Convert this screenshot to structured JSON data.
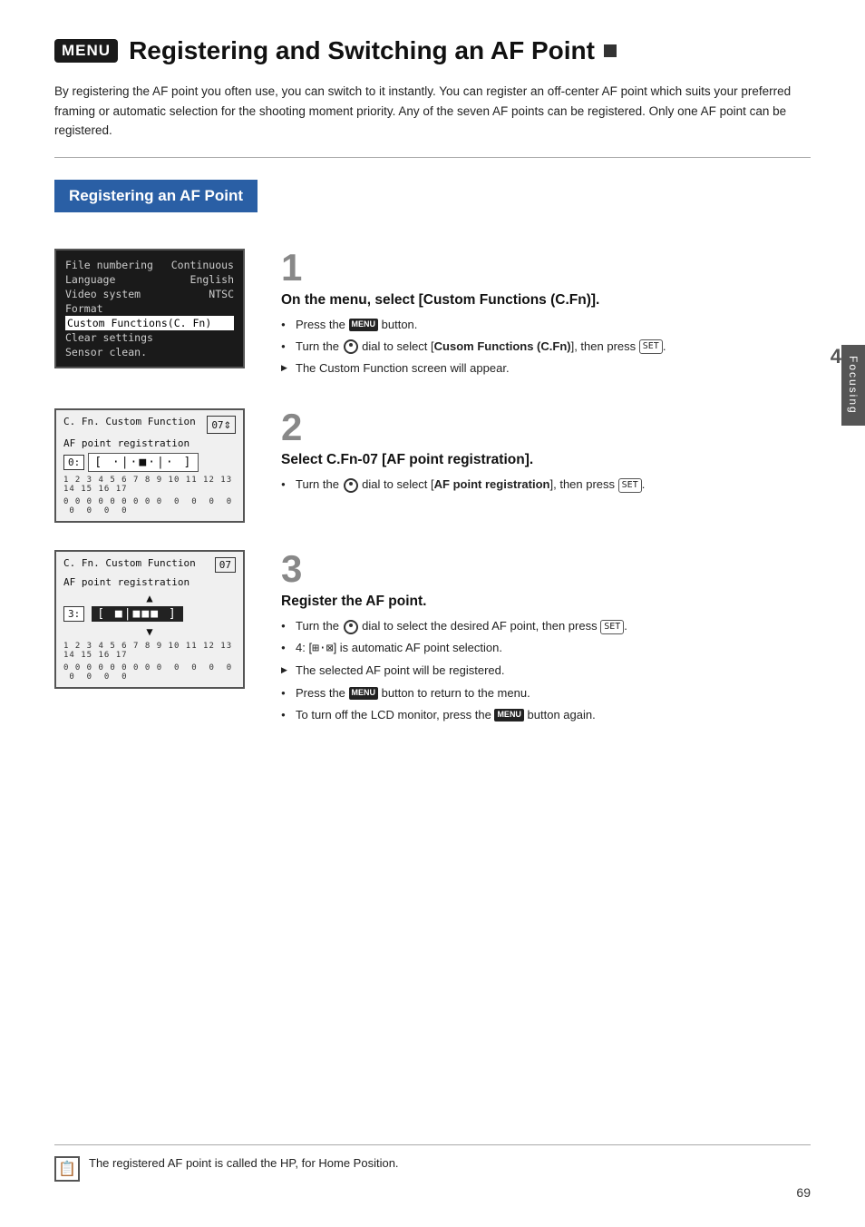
{
  "page": {
    "menu_badge": "MENU",
    "title": "Registering and Switching an AF Point",
    "intro": "By registering the AF point you often use, you can switch to it instantly. You can register an off-center AF point which suits your preferred framing or automatic selection for the shooting moment priority. Any of the seven AF points can be registered. Only one AF point can be registered.",
    "section_header": "Registering an AF Point",
    "side_tab": "Focusing",
    "side_number": "4",
    "page_number": "69",
    "footer_note": "The registered AF point is called the HP, for Home Position."
  },
  "step1": {
    "number": "1",
    "title": "On the menu, select [Custom Functions (C.Fn)].",
    "bullets": [
      {
        "type": "bullet",
        "text": "Press the <MENU> button."
      },
      {
        "type": "bullet",
        "text": "Turn the <dial> dial to select [Cusom Functions (C.Fn)], then press <SET>."
      },
      {
        "type": "arrow",
        "text": "The Custom Function screen will appear."
      }
    ]
  },
  "step2": {
    "number": "2",
    "title": "Select C.Fn-07 [AF point registration].",
    "bullets": [
      {
        "type": "bullet",
        "text": "Turn the <dial> dial to select [AF point registration], then press <SET>."
      }
    ]
  },
  "step3": {
    "number": "3",
    "title": "Register the AF point.",
    "bullets": [
      {
        "type": "bullet",
        "text": "Turn the <dial> dial to select the desired AF point, then press <SET>."
      },
      {
        "type": "bullet",
        "text": "4: [auto] is automatic AF point selection."
      },
      {
        "type": "arrow",
        "text": "The selected AF point will be registered."
      },
      {
        "type": "bullet",
        "text": "Press the <MENU> button to return to the menu."
      },
      {
        "type": "bullet",
        "text": "To turn off the LCD monitor, press the <MENU> button again."
      }
    ]
  },
  "screen1": {
    "rows": [
      {
        "label": "File numbering",
        "value": "Continuous",
        "highlighted": false
      },
      {
        "label": "Language",
        "value": "English",
        "highlighted": false
      },
      {
        "label": "Video system",
        "value": "NTSC",
        "highlighted": false
      },
      {
        "label": "Format",
        "value": "",
        "highlighted": false
      },
      {
        "label": "Custom Functions(C. Fn)",
        "value": "",
        "highlighted": true
      },
      {
        "label": "Clear settings",
        "value": "",
        "highlighted": false
      },
      {
        "label": "Sensor clean.",
        "value": "",
        "highlighted": false
      }
    ]
  },
  "screen2": {
    "title_left": "C. Fn.  Custom Function",
    "title_right": "07",
    "label": "AF point registration",
    "value_label": "0:",
    "af_display": "[ ·|·■·|· ]",
    "number_row": "1 2 3 4 5 6 7 8 9 10 11 12 13 14 15 16 17",
    "number_row2": "0 0 0 0 0 0 0 0 0  0  0  0  0  0  0  0  0"
  },
  "screen3": {
    "title_left": "C. Fn.  Custom Function",
    "title_right": "07",
    "label": "AF point registration",
    "arrow_up": "▲",
    "value_label": "3:",
    "af_display": "[ ■|■■■ ]",
    "arrow_down": "▼",
    "number_row": "1 2 3 4 5 6 7 8 9 10 11 12 13 14 15 16 17",
    "number_row2": "0 0 0 0 0 0 0 0 0  0  0  0  0  0  0  0  0"
  }
}
